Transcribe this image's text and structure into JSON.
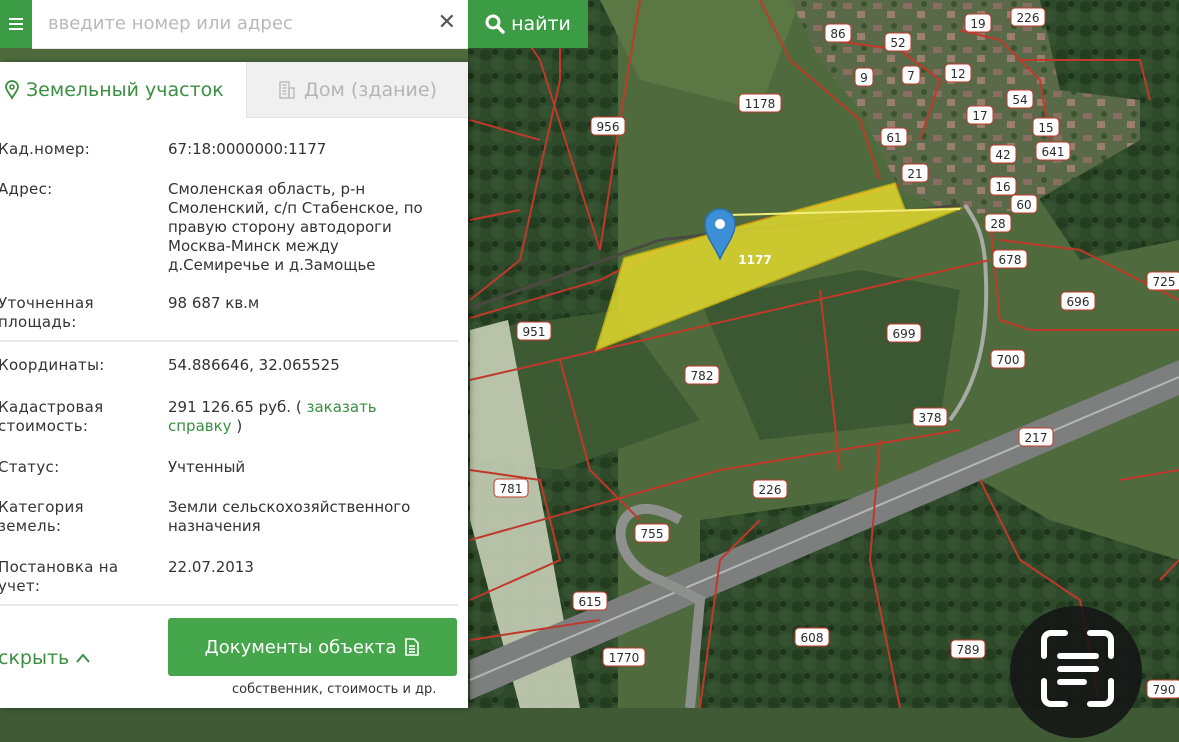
{
  "search": {
    "placeholder": "введите номер или адрес",
    "clear_icon": "close-icon",
    "find_label": "найти",
    "find_icon": "search-icon"
  },
  "tabs": [
    {
      "label": "Земельный участок",
      "icon": "location-pin-icon",
      "active": true
    },
    {
      "label": "Дом (здание)",
      "icon": "building-icon",
      "active": false
    }
  ],
  "details": {
    "cadastral_number": {
      "label": "Кад.номер:",
      "value": "67:18:0000000:1177"
    },
    "address": {
      "label": "Адрес:",
      "value": "Смоленская область, р-н Смоленский, с/п Стабенское, по правую сторону автодороги Москва-Минск между д.Семиречье и д.Замощье"
    },
    "area": {
      "label": "Уточненная площадь:",
      "value": "98 687 кв.м"
    },
    "coordinates": {
      "label": "Координаты:",
      "value": "54.886646, 32.065525"
    },
    "cadastral_value": {
      "label": "Кадастровая стоимость:",
      "value": "291 126.65 руб. (",
      "link": "заказать справку",
      "suffix": ")"
    },
    "status": {
      "label": "Статус:",
      "value": "Учтенный"
    },
    "land_category": {
      "label": "Категория земель:",
      "value": "Земли сельскохозяйственного назначения"
    },
    "registration_date": {
      "label": "Постановка на учет:",
      "value": "22.07.2013"
    }
  },
  "footer": {
    "hide_label": "скрыть",
    "hide_icon": "chevron-up-icon",
    "docs_button": "Документы объекта",
    "docs_icon": "document-icon",
    "docs_note": "собственник, стоимость и др."
  },
  "map": {
    "selected_parcel": "1177",
    "parcel_labels": [
      "1178",
      "956",
      "951",
      "782",
      "699",
      "696",
      "700",
      "378",
      "217",
      "226",
      "781",
      "755",
      "615",
      "608",
      "789",
      "1770",
      "86",
      "52",
      "9",
      "7",
      "12",
      "19",
      "61",
      "17",
      "54",
      "15",
      "641",
      "42",
      "21",
      "16",
      "60",
      "28",
      "678",
      "725",
      "790",
      "226"
    ],
    "marker_icon": "map-pin-icon",
    "scan_icon": "text-scan-icon",
    "colors": {
      "highlight": "#e6dd2c",
      "boundary": "#c0392b",
      "accent": "#3c9b45"
    }
  }
}
